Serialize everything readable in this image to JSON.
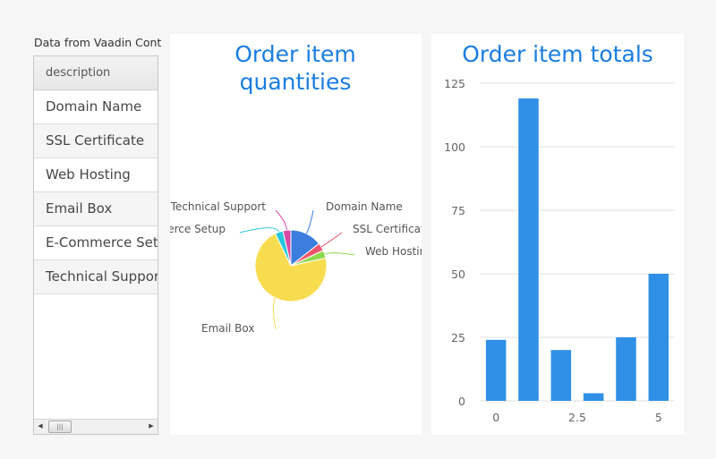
{
  "table": {
    "caption": "Data from Vaadin Cont",
    "header": "description",
    "rows": [
      "Domain Name",
      "SSL Certificate",
      "Web Hosting",
      "Email Box",
      "E-Commerce Setup",
      "Technical Support"
    ],
    "scroll_left_icon": "triangle-left-icon",
    "scroll_right_icon": "triangle-right-icon",
    "scroll_thumb_grip": "|||"
  },
  "pie": {
    "title": "Order item quantities",
    "chart_data": {
      "type": "pie",
      "slices": [
        {
          "label": "Domain Name",
          "value": 24,
          "color": "#3b7ee0"
        },
        {
          "label": "SSL Certificate",
          "value": 6,
          "color": "#f0546c"
        },
        {
          "label": "Web Hosting",
          "value": 6,
          "color": "#8ed84c"
        },
        {
          "label": "Email Box",
          "value": 119,
          "color": "#f7dc50"
        },
        {
          "label": "E-Commerce Setup",
          "value": 6,
          "color": "#27c6d9"
        },
        {
          "label": "Technical Support",
          "value": 6,
          "color": "#d94aa5"
        }
      ]
    }
  },
  "bar": {
    "title": "Order item totals",
    "chart_data": {
      "type": "bar",
      "x": [
        0,
        1,
        2,
        3,
        4,
        5
      ],
      "values": [
        24,
        119,
        20,
        3,
        25,
        50
      ],
      "color": "#3090e8",
      "ylim": [
        0,
        125
      ],
      "yticks": [
        0,
        25,
        50,
        75,
        100,
        125
      ],
      "xticks": [
        "0",
        "2.5",
        "5"
      ],
      "xtick_values": [
        0,
        2.5,
        5
      ],
      "grid": true
    }
  }
}
